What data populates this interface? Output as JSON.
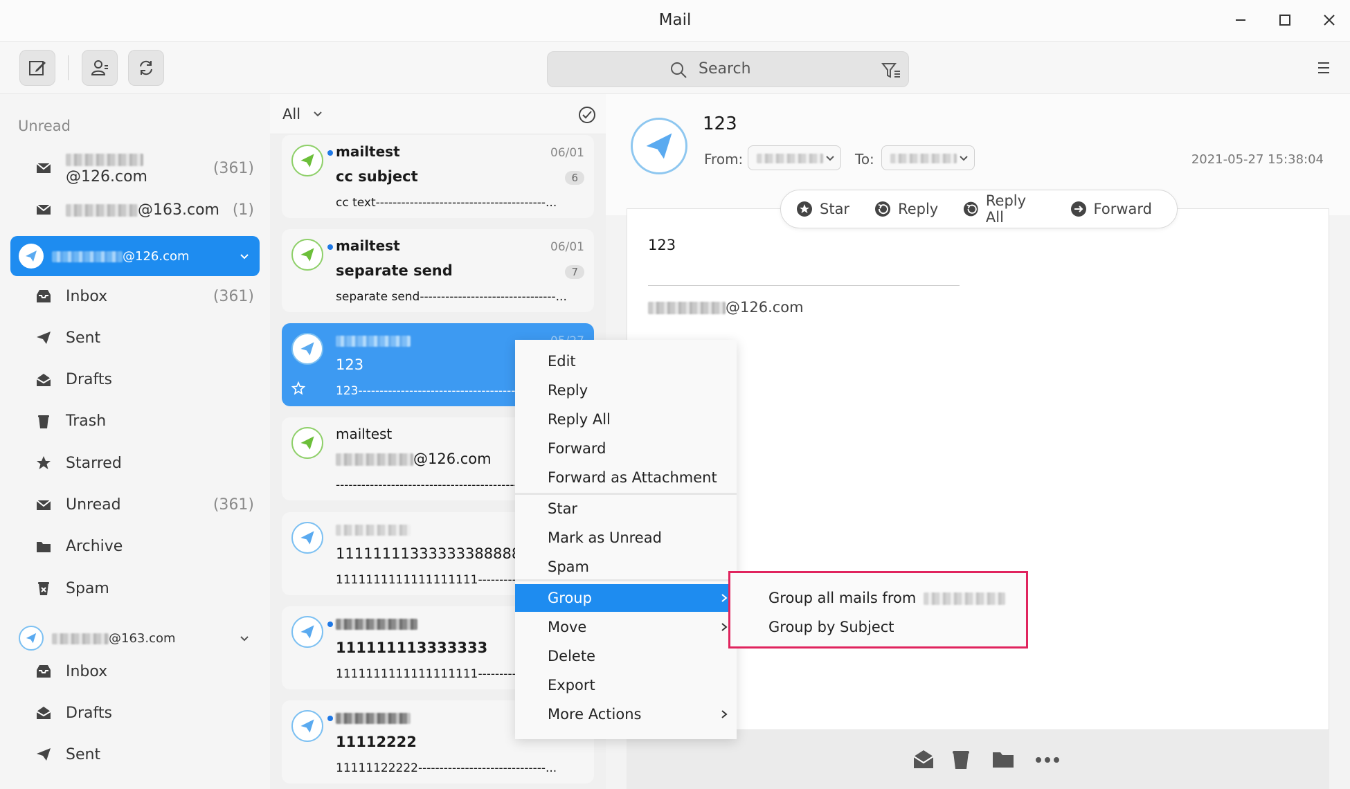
{
  "window": {
    "title": "Mail"
  },
  "toolbar": {
    "search_placeholder": "Search"
  },
  "sidebar": {
    "section_label": "Unread",
    "top_accounts": [
      {
        "domain": "@126.com",
        "count": "(361)"
      },
      {
        "domain": "@163.com",
        "count": "(1)"
      }
    ],
    "active_account": {
      "domain": "@126.com"
    },
    "account1_folders": [
      {
        "label": "Inbox",
        "count": "(361)",
        "icon": "inbox-icon"
      },
      {
        "label": "Sent",
        "count": "",
        "icon": "send-icon"
      },
      {
        "label": "Drafts",
        "count": "",
        "icon": "drafts-icon"
      },
      {
        "label": "Trash",
        "count": "",
        "icon": "trash-icon"
      },
      {
        "label": "Starred",
        "count": "",
        "icon": "star-icon"
      },
      {
        "label": "Unread",
        "count": "(361)",
        "icon": "unread-icon"
      },
      {
        "label": "Archive",
        "count": "",
        "icon": "folder-icon"
      },
      {
        "label": "Spam",
        "count": "",
        "icon": "spam-icon"
      }
    ],
    "account2": {
      "domain": "@163.com"
    },
    "account2_folders": [
      {
        "label": "Inbox"
      },
      {
        "label": "Drafts"
      },
      {
        "label": "Sent"
      }
    ]
  },
  "list": {
    "filter": "All",
    "mails": [
      {
        "from": "mailtest",
        "date": "06/01",
        "subject": "cc subject",
        "badge": "6",
        "preview": "cc text----------------------------------------..."
      },
      {
        "from": "mailtest",
        "date": "06/01",
        "subject": "separate send",
        "badge": "7",
        "preview": "separate send--------------------------------..."
      },
      {
        "from": "",
        "date": "05/27",
        "subject": "123",
        "badge": "",
        "preview": "123------------------------------------------------..."
      },
      {
        "from": "mailtest",
        "date": "",
        "subject": "@126.com",
        "badge": "",
        "preview": "------------------------------------------------------..."
      },
      {
        "from": "",
        "date": "",
        "subject": "1111111133333338888888",
        "badge": "",
        "preview": "1111111111111111111-------------------------..."
      },
      {
        "from": "",
        "date": "",
        "subject": "111111113333333",
        "badge": "",
        "preview": "1111111111111111111-------------------------..."
      },
      {
        "from": "",
        "date": "",
        "subject": "11112222",
        "badge": "",
        "preview": "11111122222------------------------------..."
      }
    ]
  },
  "reader": {
    "subject": "123",
    "from_label": "From:",
    "to_label": "To:",
    "datetime": "2021-05-27 15:38:04",
    "actions": {
      "star": "Star",
      "reply": "Reply",
      "reply_all": "Reply All",
      "forward": "Forward"
    },
    "body_text": "123",
    "signature_domain": "@126.com"
  },
  "context_menu": {
    "items": [
      "Edit",
      "Reply",
      "Reply All",
      "Forward",
      "Forward as Attachment",
      "Star",
      "Mark as Unread",
      "Spam",
      "Group",
      "Move",
      "Delete",
      "Export",
      "More Actions"
    ],
    "highlighted": "Group"
  },
  "submenu": {
    "items": [
      "Group all mails from",
      "Group by Subject"
    ]
  },
  "colors": {
    "accent": "#1e8cf0",
    "highlight_border": "#e0245e",
    "avatar_green": "#8fd06a"
  }
}
